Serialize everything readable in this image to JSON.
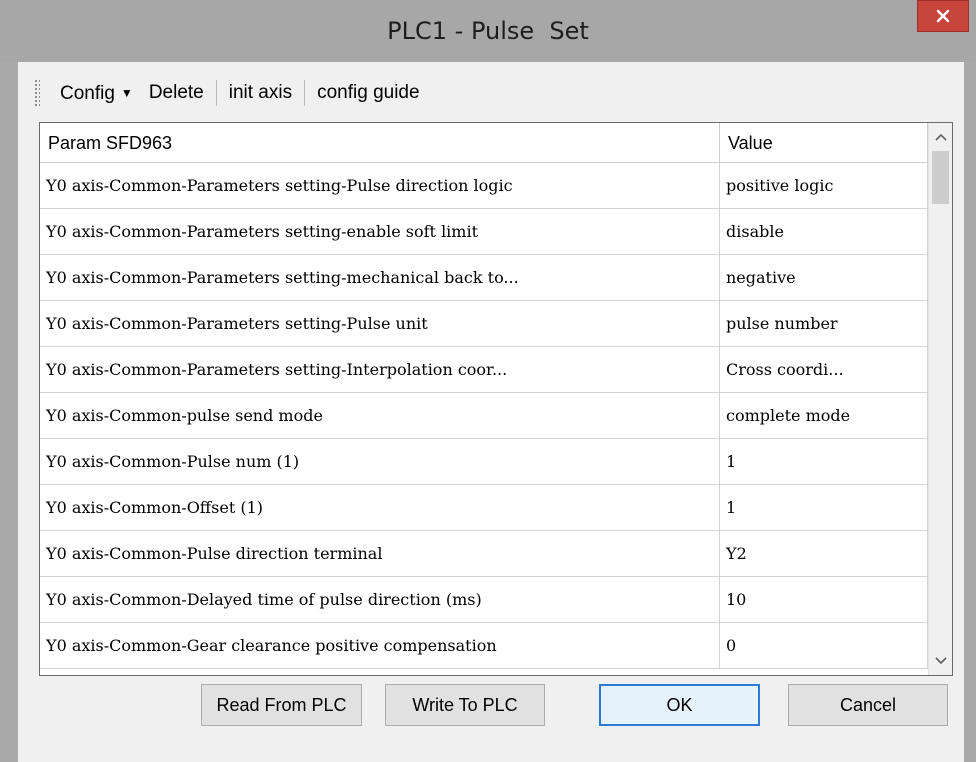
{
  "window": {
    "title": "PLC1 - Pulse  Set",
    "close_symbol": "×"
  },
  "toolbar": {
    "config_label": "Config",
    "delete_label": "Delete",
    "init_axis_label": "init axis",
    "config_guide_label": "config guide"
  },
  "table": {
    "columns": [
      "Param SFD963",
      "Value"
    ],
    "rows": [
      {
        "param": "Y0 axis-Common-Parameters setting-Pulse direction logic",
        "value": "positive logic"
      },
      {
        "param": "Y0 axis-Common-Parameters setting-enable soft limit",
        "value": "disable"
      },
      {
        "param": "Y0 axis-Common-Parameters setting-mechanical back to...",
        "value": "negative"
      },
      {
        "param": "Y0 axis-Common-Parameters setting-Pulse unit",
        "value": "pulse number"
      },
      {
        "param": "Y0 axis-Common-Parameters setting-Interpolation coor...",
        "value": "Cross coordi..."
      },
      {
        "param": "Y0 axis-Common-pulse send mode",
        "value": "complete mode"
      },
      {
        "param": "Y0 axis-Common-Pulse num (1)",
        "value": "1"
      },
      {
        "param": "Y0 axis-Common-Offset (1)",
        "value": "1"
      },
      {
        "param": "Y0 axis-Common-Pulse direction terminal",
        "value": "Y2"
      },
      {
        "param": "Y0 axis-Common-Delayed time of pulse direction (ms)",
        "value": "10"
      },
      {
        "param": "Y0 axis-Common-Gear clearance positive compensation",
        "value": "0"
      }
    ]
  },
  "buttons": {
    "read": "Read From PLC",
    "write": "Write To PLC",
    "ok": "OK",
    "cancel": "Cancel"
  },
  "colors": {
    "close_button": "#c7463c",
    "ok_button_border": "#2a7bd4",
    "title_bar": "#a7a7a7"
  }
}
